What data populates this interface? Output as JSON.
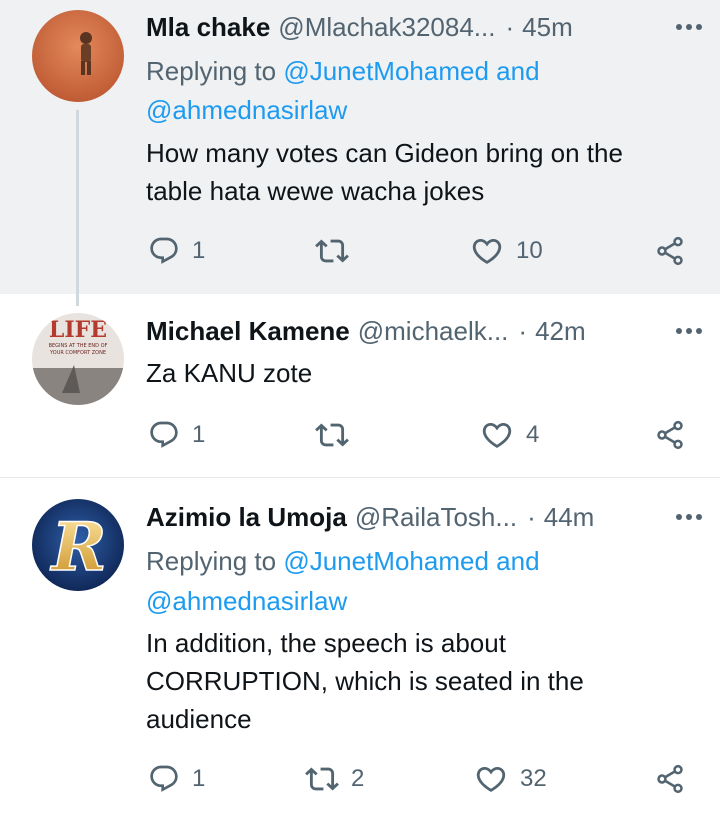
{
  "tweets": [
    {
      "name": "Mla chake",
      "handle": "@Mlachak32084...",
      "dot": "·",
      "time": "45m",
      "reply_prefix": "Replying to",
      "reply_line1": "@JunetMohamed and",
      "reply_line2": "@ahmednasirlaw",
      "text_lines": [
        "How many votes can Gideon bring on the",
        "table hata wewe wacha jokes"
      ],
      "replies": "1",
      "retweets": "",
      "likes": "10"
    },
    {
      "name": "Michael Kamene",
      "handle": "@michaelk...",
      "dot": "·",
      "time": "42m",
      "avatar_text_1": "LIFE",
      "avatar_text_2": "BEGINS AT THE END OF",
      "avatar_text_3": "YOUR COMFORT ZONE",
      "text_lines": [
        "Za KANU zote"
      ],
      "replies": "1",
      "retweets": "",
      "likes": "4"
    },
    {
      "name": "Azimio la Umoja",
      "handle": "@RailaTosh...",
      "dot": "·",
      "time": "44m",
      "avatar_letter": "R",
      "reply_prefix": "Replying to",
      "reply_line1": "@JunetMohamed and",
      "reply_line2": "@ahmednasirlaw",
      "text_lines": [
        "In addition, the speech is about",
        "CORRUPTION, which is seated in the",
        "audience"
      ],
      "replies": "1",
      "retweets": "2",
      "likes": "32"
    }
  ],
  "icons": {
    "reply": "reply-icon",
    "retweet": "retweet-icon",
    "like": "heart-icon",
    "share": "share-icon",
    "more": "more-icon"
  },
  "colors": {
    "link": "#1d9bf0",
    "secondary_text": "#536471",
    "highlight_bg": "#eff1f3"
  }
}
